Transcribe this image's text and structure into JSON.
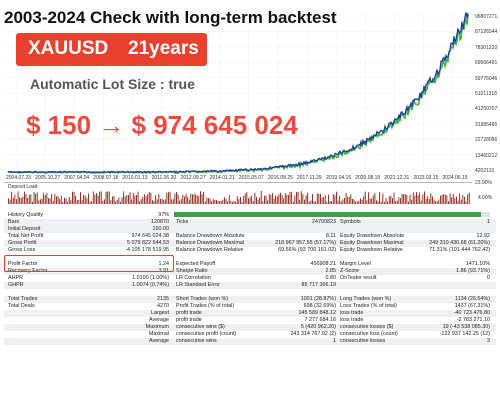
{
  "overlay": {
    "headline": "2003-2024 Check with long-term backtest",
    "symbol": "XAUUSD",
    "years": "21years",
    "lot_size": "Automatic Lot Size : true",
    "growth": "$ 150  → $ 974 645 024"
  },
  "chart": {
    "balance_color": "#1f3f9c",
    "equity_color": "#44b549",
    "deposit_color": "#8b1e10",
    "y_labels": [
      "96807271",
      "87126544",
      "78301220",
      "69566491",
      "59776046",
      "51011318",
      "41250707",
      "31985486",
      "22728096",
      "13460212",
      "4202131"
    ],
    "x_labels": [
      "2004.07.23",
      "2005.10.27",
      "2007.04.04",
      "2008.07.18",
      "2010.01.13",
      "2011.06.20",
      "2012.09.27",
      "2014.01.21",
      "2015.05.07",
      "2016.08.25",
      "2017.11.29",
      "2019.04.16",
      "2020.08.19",
      "2021.12.31",
      "2023.03.15",
      "2024.06.19"
    ],
    "deposit_load_label": "Deposit Load",
    "deposit_y_labels": [
      "23.90%",
      "4.00%"
    ]
  },
  "stats": {
    "history_quality_label": "History Quality",
    "history_quality_value": "97%",
    "history_quality_fraction": 0.97,
    "bars_label": "Bars",
    "bars_value": "120870",
    "ticks_label": "Ticks",
    "ticks_value": "24700823",
    "symbols_label": "Symbols",
    "symbols_value": "1",
    "rows": [
      [
        [
          "Initial Deposit",
          "150.00"
        ],
        [
          "",
          ""
        ],
        [
          "",
          ""
        ]
      ],
      [
        [
          "Total Net Profit",
          "974 645 024.38"
        ],
        [
          "Balance Drawdown Absolute",
          "8.11"
        ],
        [
          "Equity Drawdown Absolute",
          "12.92"
        ]
      ],
      [
        [
          "Gross Profit",
          "5 079 822 544.53"
        ],
        [
          "Balance Drawdown Maximal",
          "218 967 957.55 (57.17%)"
        ],
        [
          "Equity Drawdown Maximal",
          "249 310 430.68 (61.20%)"
        ]
      ],
      [
        [
          "Gross Loss",
          "-4 105 178 519.95"
        ],
        [
          "Balance Drawdown Relative",
          "69.56% (93 700 161.02)"
        ],
        [
          "Equity Drawdown Relative",
          "71.31% (101 444 762.42)"
        ]
      ],
      [
        [
          "",
          ""
        ],
        [
          "",
          ""
        ],
        [
          "",
          ""
        ]
      ],
      [
        [
          "Profit Factor",
          "1.24"
        ],
        [
          "Expected Payoff",
          "456908.21"
        ],
        [
          "Margin Level",
          "1471.10%"
        ]
      ],
      [
        [
          "Recovery Factor",
          "3.91"
        ],
        [
          "Sharpe Ratio",
          "2.85"
        ],
        [
          "Z-Score",
          "1.86 (93.71%)"
        ]
      ],
      [
        [
          "AHPR",
          "1.0100 (1.00%)"
        ],
        [
          "LR Correlation",
          "0.80"
        ],
        [
          "OnTester result",
          "0"
        ]
      ],
      [
        [
          "GHPR",
          "1.0074 (0.74%)"
        ],
        [
          "LR Standard Error",
          "85 717 366.19"
        ],
        [
          "",
          ""
        ]
      ],
      [
        [
          "",
          ""
        ],
        [
          "",
          ""
        ],
        [
          "",
          ""
        ]
      ],
      [
        [
          "Total Trades",
          "2135"
        ],
        [
          "Short Trades (won %)",
          "1001 (28.87%)"
        ],
        [
          "Long Trades (won %)",
          "1134 (26.54%)"
        ]
      ],
      [
        [
          "Total Deals",
          "4270"
        ],
        [
          "Profit Trades (% of total)",
          "698 (32.69%)"
        ],
        [
          "Loss Trades (% of total)",
          "1437 (67.31%)"
        ]
      ],
      [
        [
          "Largest",
          ""
        ],
        [
          "profit trade",
          "145 589 848.12"
        ],
        [
          "loss trade",
          "-40 723 476.80"
        ]
      ],
      [
        [
          "Average",
          ""
        ],
        [
          "profit trade",
          "7 277 684.16"
        ],
        [
          "loss trade",
          "-2 783 271.10"
        ]
      ],
      [
        [
          "Maximum",
          ""
        ],
        [
          "consecutive wins ($)",
          "5 (420 962.20)"
        ],
        [
          "consecutive losses ($)",
          "19 (-43 538 085.30)"
        ]
      ],
      [
        [
          "Maximal",
          ""
        ],
        [
          "consecutive profit (count)",
          "243 314 767.92 (2)"
        ],
        [
          "consecutive loss (count)",
          "-122 937 142.25 (12)"
        ]
      ],
      [
        [
          "Average",
          ""
        ],
        [
          "consecutive wins",
          "1"
        ],
        [
          "consecutive losses",
          "3"
        ]
      ]
    ]
  }
}
